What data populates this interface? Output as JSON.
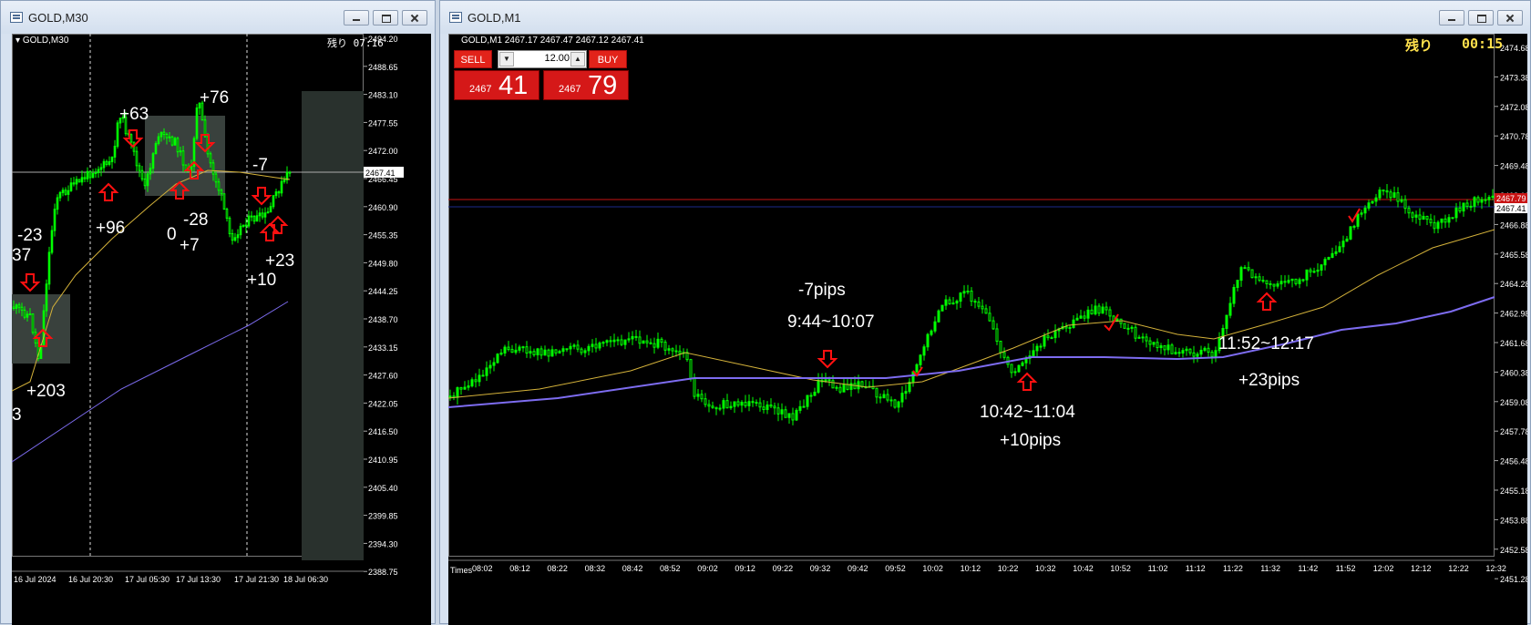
{
  "left_window": {
    "title": "GOLD,M30",
    "symbol_label": "GOLD,M30",
    "remaining": "残り 07:16",
    "price_axis": [
      "2494.20",
      "2488.65",
      "2483.10",
      "2477.55",
      "2472.00",
      "2466.45",
      "2460.90",
      "2455.35",
      "2449.80",
      "2444.25",
      "2438.70",
      "2433.15",
      "2427.60",
      "2422.05",
      "2416.50",
      "2410.95",
      "2405.40",
      "2399.85",
      "2394.30",
      "2388.75"
    ],
    "current_price_tag": "2467.41",
    "time_axis": [
      "16 Jul 2024",
      "16 Jul 20:30",
      "17 Jul 05:30",
      "17 Jul 13:30",
      "17 Jul 21:30",
      "18 Jul 06:30"
    ],
    "annotations": [
      "+63",
      "+76",
      "-7",
      "-23",
      "37",
      "+96",
      "-28",
      "0",
      "+7",
      "+23",
      "+10",
      "+203",
      "3"
    ]
  },
  "right_window": {
    "title": "GOLD,M1",
    "symbol_label": "GOLD,M1  2467.17 2467.47 2467.12 2467.41",
    "remaining_label": "残り",
    "remaining_time": "00:15",
    "one_click": {
      "sell_label": "SELL",
      "buy_label": "BUY",
      "volume": "12.00",
      "sell_price_small": "2467",
      "sell_price_big": "41",
      "buy_price_small": "2467",
      "buy_price_big": "79"
    },
    "price_axis": [
      "2474.68",
      "2473.38",
      "2472.08",
      "2470.78",
      "2469.48",
      "2468.18",
      "2466.88",
      "2465.58",
      "2464.28",
      "2462.98",
      "2461.68",
      "2460.38",
      "2459.08",
      "2457.78",
      "2456.48",
      "2455.18",
      "2453.88",
      "2452.58",
      "2451.28"
    ],
    "price_tags": [
      "2467.79",
      "2467.41"
    ],
    "time_axis_label": "Times",
    "time_axis": [
      "08:02",
      "08:12",
      "08:22",
      "08:32",
      "08:42",
      "08:52",
      "09:02",
      "09:12",
      "09:22",
      "09:32",
      "09:42",
      "09:52",
      "10:02",
      "10:12",
      "10:22",
      "10:32",
      "10:42",
      "10:52",
      "11:02",
      "11:12",
      "11:22",
      "11:32",
      "11:42",
      "11:52",
      "12:02",
      "12:12",
      "12:22",
      "12:32"
    ],
    "annotations": {
      "a1": "-7pips",
      "a2": "9:44~10:07",
      "a3": "10:42~11:04",
      "a4": "+10pips",
      "a5": "11:52~12:17",
      "a6": "+23pips"
    }
  },
  "colors": {
    "candle": "#00ff00",
    "ma_fast": "#d4b23a",
    "ma_slow": "#7d6cf0",
    "ask_line": "#c81414",
    "arrow": "#ff1010"
  }
}
